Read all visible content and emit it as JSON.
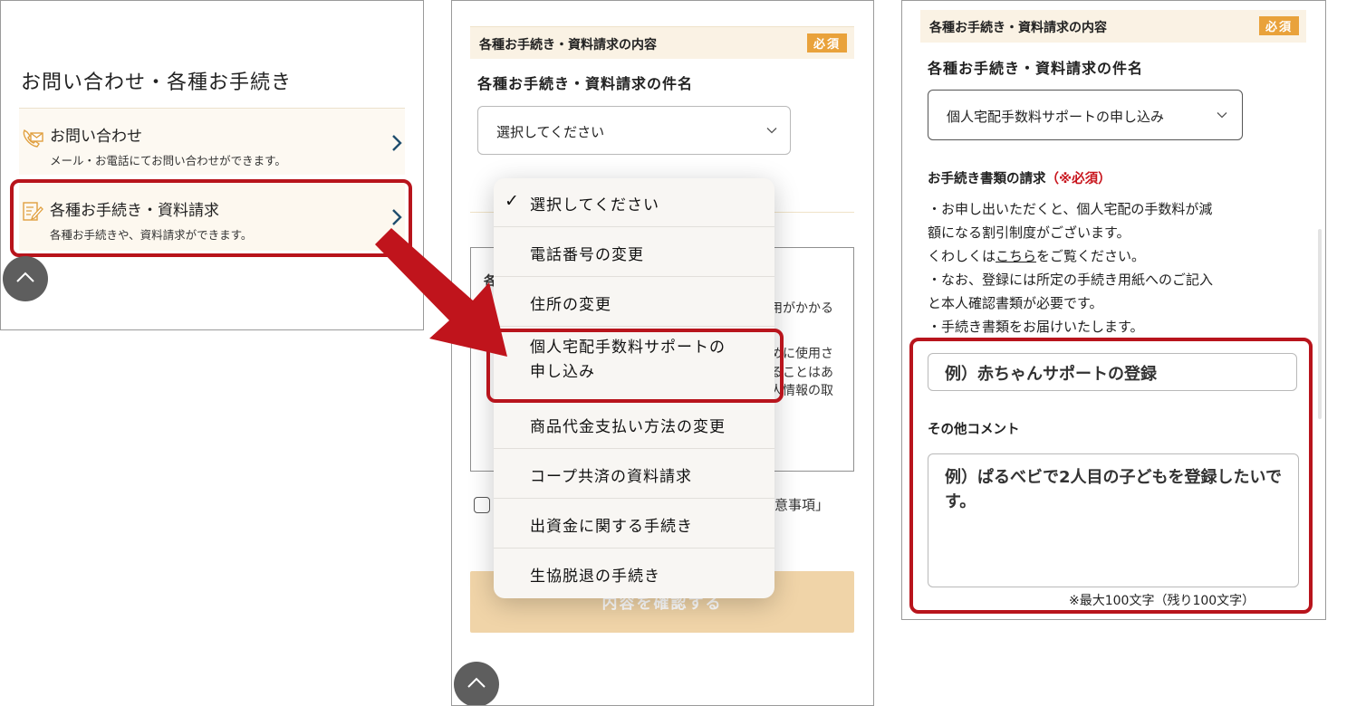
{
  "panel1": {
    "heading": "お問い合わせ・各種お手続き",
    "menu": [
      {
        "title": "お問い合わせ",
        "subtitle": "メール・お電話にてお問い合わせができます。",
        "icon": "phone-mail-icon"
      },
      {
        "title": "各種お手続き・資料請求",
        "subtitle": "各種お手続きや、資料請求ができます。",
        "icon": "document-edit-icon"
      }
    ]
  },
  "panel2": {
    "section_label": "各種お手続き・資料請求の内容",
    "required_badge": "必須",
    "field_label": "各種お手続き・資料請求の件名",
    "select_value": "選択してください",
    "behind_fragments": [
      "各",
      "用がかかる",
      "めに使用さ",
      "ることはあ",
      "人情報の取",
      "意事項」"
    ],
    "confirm_button": "内容を確認する",
    "dropdown_options": [
      {
        "label": "選択してください",
        "checked": true
      },
      {
        "label": "電話番号の変更"
      },
      {
        "label": "住所の変更"
      },
      {
        "label_line1": "個人宅配手数料サポートの",
        "label_line2": "申し込み"
      },
      {
        "label": "商品代金支払い方法の変更"
      },
      {
        "label": "コープ共済の資料請求"
      },
      {
        "label": "出資金に関する手続き"
      },
      {
        "label": "生協脱退の手続き"
      }
    ]
  },
  "panel3": {
    "section_label": "各種お手続き・資料請求の内容",
    "required_badge": "必須",
    "field_label": "各種お手続き・資料請求の件名",
    "select_value": "個人宅配手数料サポートの申し込み",
    "request_label": "お手続き書類の請求",
    "request_required": "（※必須）",
    "description": {
      "line1": "・お申し出いただくと、個人宅配の手数料が減",
      "line2": "額になる割引制度がございます。",
      "line3_pre": "くわしくは",
      "line3_link": "こちら",
      "line3_post": "をご覧ください。",
      "line4": "・なお、登録には所定の手続き用紙へのご記入",
      "line5": "と本人確認書類が必要です。",
      "line6": "・手続き書類をお届けいたします。"
    },
    "input_placeholder": "例）赤ちゃんサポートの登録",
    "comment_label": "その他コメント",
    "comment_placeholder": "例）ぱるべビで2人目の子どもを登録したいです。",
    "counter": "※最大100文字（残り100文字）"
  },
  "colors": {
    "accent": "#e9a23b",
    "highlight": "#b8141c",
    "section_bg": "#faf2e4",
    "button_disabled": "#f0d4a8"
  }
}
